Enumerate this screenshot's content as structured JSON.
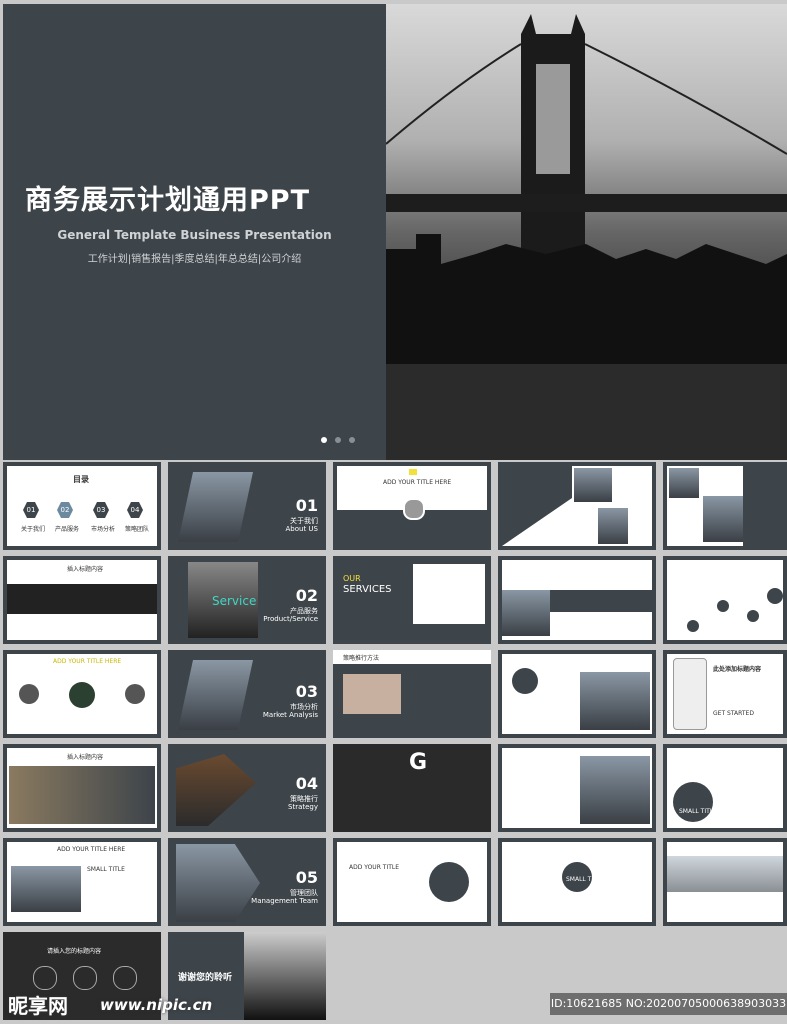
{
  "hero": {
    "title": "商务展示计划通用PPT",
    "subtitle_en": "General Template Business Presentation",
    "subtitle_cn": "工作计划|销售报告|季度总结|年总总结|公司介绍"
  },
  "thumbs": {
    "toc_label": "目录",
    "toc_nums": [
      "01",
      "02",
      "03",
      "04"
    ],
    "toc_items": [
      "关于我们",
      "产品服务",
      "市场分析",
      "策略团队"
    ],
    "add_title": "ADD YOUR TITLE HERE",
    "sec01_num": "01",
    "sec01_cn": "关于我们",
    "sec01_en": "About US",
    "sec02_num": "02",
    "sec02_cn": "产品服务",
    "sec02_en": "Product/Service",
    "sec03_num": "03",
    "sec03_cn": "市场分析",
    "sec03_en": "Market Analysis",
    "sec04_num": "04",
    "sec04_cn": "策略推行",
    "sec04_en": "Strategy",
    "sec05_num": "05",
    "sec05_cn": "管理团队",
    "sec05_en": "Management Team",
    "service_word": "Service",
    "our_services_1": "OUR",
    "our_services_2": "SERVICES",
    "strategy_label": "策略推行方法",
    "insert_title": "插入标题内容",
    "big_g": "G",
    "small_title": "SMALL TITLE",
    "add_your_title_small": "ADD YOUR TITLE",
    "get_started": "GET STARTED",
    "add_title_cn": "此处添加标题内容",
    "insert_title2": "请插入您的标题内容",
    "thanks": "谢谢您的聆听"
  },
  "watermark": {
    "brand": "昵享网",
    "url": "www.nipic.cn",
    "id_text": "ID:10621685 NO:20200705000638903033"
  },
  "colors": {
    "dark": "#3d444a",
    "accent": "#f3e03a",
    "service_green": "#3fd6c4"
  }
}
